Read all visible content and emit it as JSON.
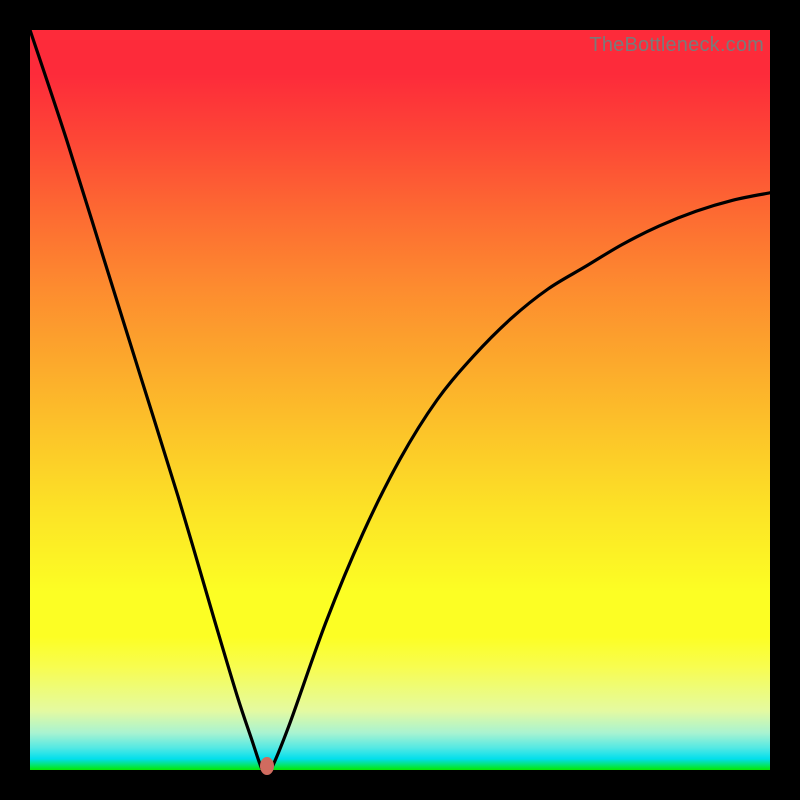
{
  "watermark": "TheBottleneck.com",
  "colors": {
    "background": "#000000",
    "curve": "#000000",
    "marker": "#d06b5f",
    "gradient_top": "#fd2b3a",
    "gradient_mid": "#fcfe24",
    "gradient_bottom": "#04e802"
  },
  "chart_data": {
    "type": "line",
    "title": "",
    "xlabel": "",
    "ylabel": "",
    "xlim": [
      0,
      100
    ],
    "ylim": [
      0,
      100
    ],
    "grid": false,
    "series": [
      {
        "name": "bottleneck-curve",
        "x": [
          0,
          5,
          10,
          15,
          20,
          25,
          28,
          30,
          31,
          31.5,
          32.5,
          35,
          40,
          45,
          50,
          55,
          60,
          65,
          70,
          75,
          80,
          85,
          90,
          95,
          100
        ],
        "y": [
          100,
          85,
          69,
          53,
          37,
          20,
          10,
          4,
          1,
          0,
          0,
          6,
          20,
          32,
          42,
          50,
          56,
          61,
          65,
          68,
          71,
          73.5,
          75.5,
          77,
          78
        ]
      }
    ],
    "annotations": [
      {
        "name": "optimal-marker",
        "x": 32,
        "y": 0.5
      }
    ]
  }
}
